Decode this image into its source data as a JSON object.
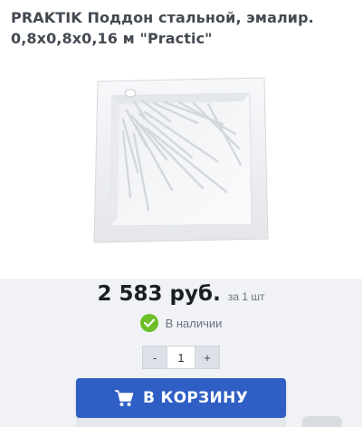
{
  "product": {
    "title_line1": "PRAKTIK Поддон стальной, эмалир.",
    "title_line2": "0,8х0,8х0,16 м \"Practic\""
  },
  "purchase": {
    "price": "2 583 руб.",
    "per_unit": "за 1 шт",
    "stock_status": "В наличии",
    "quantity": {
      "minus": "-",
      "value": "1",
      "plus": "+"
    },
    "add_to_cart_label": "В КОРЗИНУ"
  },
  "colors": {
    "accent_button": "#2f5fc4",
    "in_stock": "#6cbf26",
    "panel_background": "#f0f2f6"
  },
  "icons": {
    "stock": "check-circle-icon",
    "cart": "cart-icon"
  }
}
